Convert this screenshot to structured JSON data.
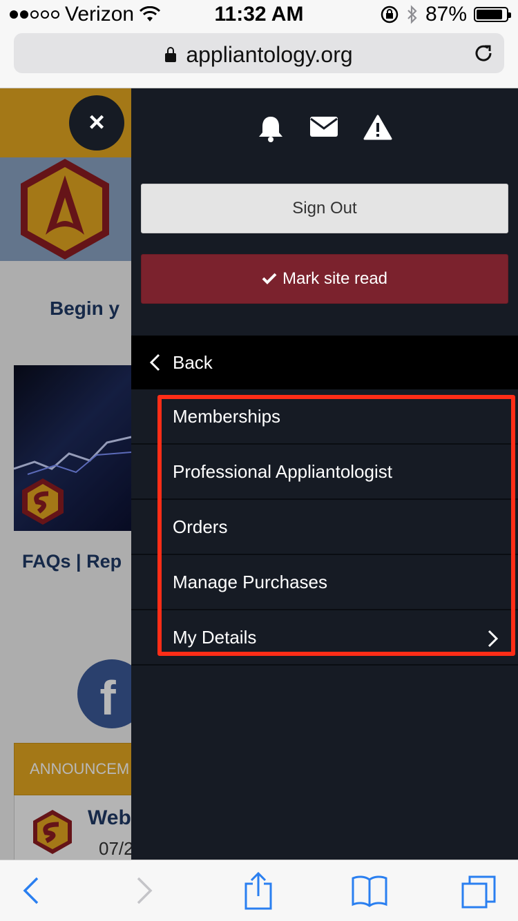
{
  "status_bar": {
    "carrier": "Verizon",
    "time": "11:32 AM",
    "battery": "87%",
    "battery_level": 0.87
  },
  "browser": {
    "url": "appliantology.org"
  },
  "background_page": {
    "begin_text": "Begin y",
    "faqs_text": "FAQs | Rep",
    "facebook_letter": "f",
    "announce_text": "ANNOUNCEM",
    "card_title": "Web",
    "card_date": "07/2"
  },
  "menu": {
    "close_glyph": "×",
    "sign_out_label": "Sign Out",
    "mark_read_label": "Mark site read",
    "back_label": "Back",
    "items": [
      {
        "label": "Memberships"
      },
      {
        "label": "Professional Appliantologist"
      },
      {
        "label": "Orders"
      },
      {
        "label": "Manage Purchases"
      },
      {
        "label": "My Details"
      }
    ]
  },
  "colors": {
    "menu_background": "#161b24",
    "mark_read_button": "#7b222d",
    "highlight_border": "#ff2d17",
    "header_gold": "#e3a720",
    "ios_blue": "#2a7ff0"
  }
}
